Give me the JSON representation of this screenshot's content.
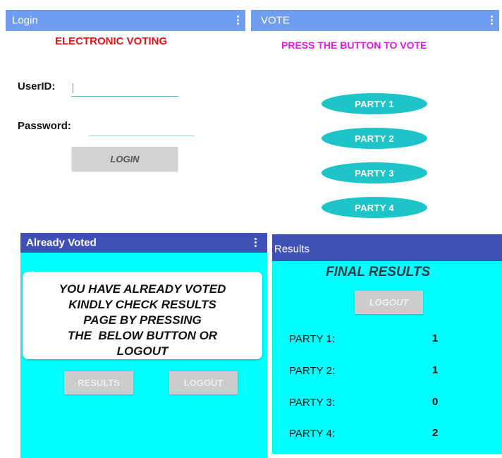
{
  "login": {
    "title": "Login",
    "heading": "ELECTRONIC VOTING",
    "userid_label": "UserID:",
    "password_label": "Password:",
    "login_button": "LOGIN"
  },
  "vote": {
    "title": "VOTE",
    "instruction": "PRESS THE BUTTON TO VOTE",
    "parties": [
      "PARTY 1",
      "PARTY 2",
      "PARTY 3",
      "PARTY 4"
    ]
  },
  "already": {
    "title": "Already Voted",
    "message": [
      "YOU HAVE ALREADY VOTED",
      "KINDLY CHECK RESULTS",
      "PAGE BY PRESSING",
      "THE  BELOW BUTTON OR",
      "LOGOUT"
    ],
    "results_button": "RESULTS",
    "logout_button": "LOGOUT"
  },
  "results": {
    "title": "Results",
    "heading": "FINAL RESULTS",
    "logout_button": "LOGOUT",
    "rows": [
      {
        "party": "PARTY 1:",
        "count": "1"
      },
      {
        "party": "PARTY 2:",
        "count": "1"
      },
      {
        "party": "PARTY 3:",
        "count": "0"
      },
      {
        "party": "PARTY 4:",
        "count": "2"
      }
    ]
  },
  "colors": {
    "appbar": "#3f51b5",
    "loginbar": "#6f9df0",
    "cyan": "#00ffff",
    "oval": "#1ec5c8",
    "heading_red": "#ee1111",
    "heading_magenta": "#e619e6"
  }
}
